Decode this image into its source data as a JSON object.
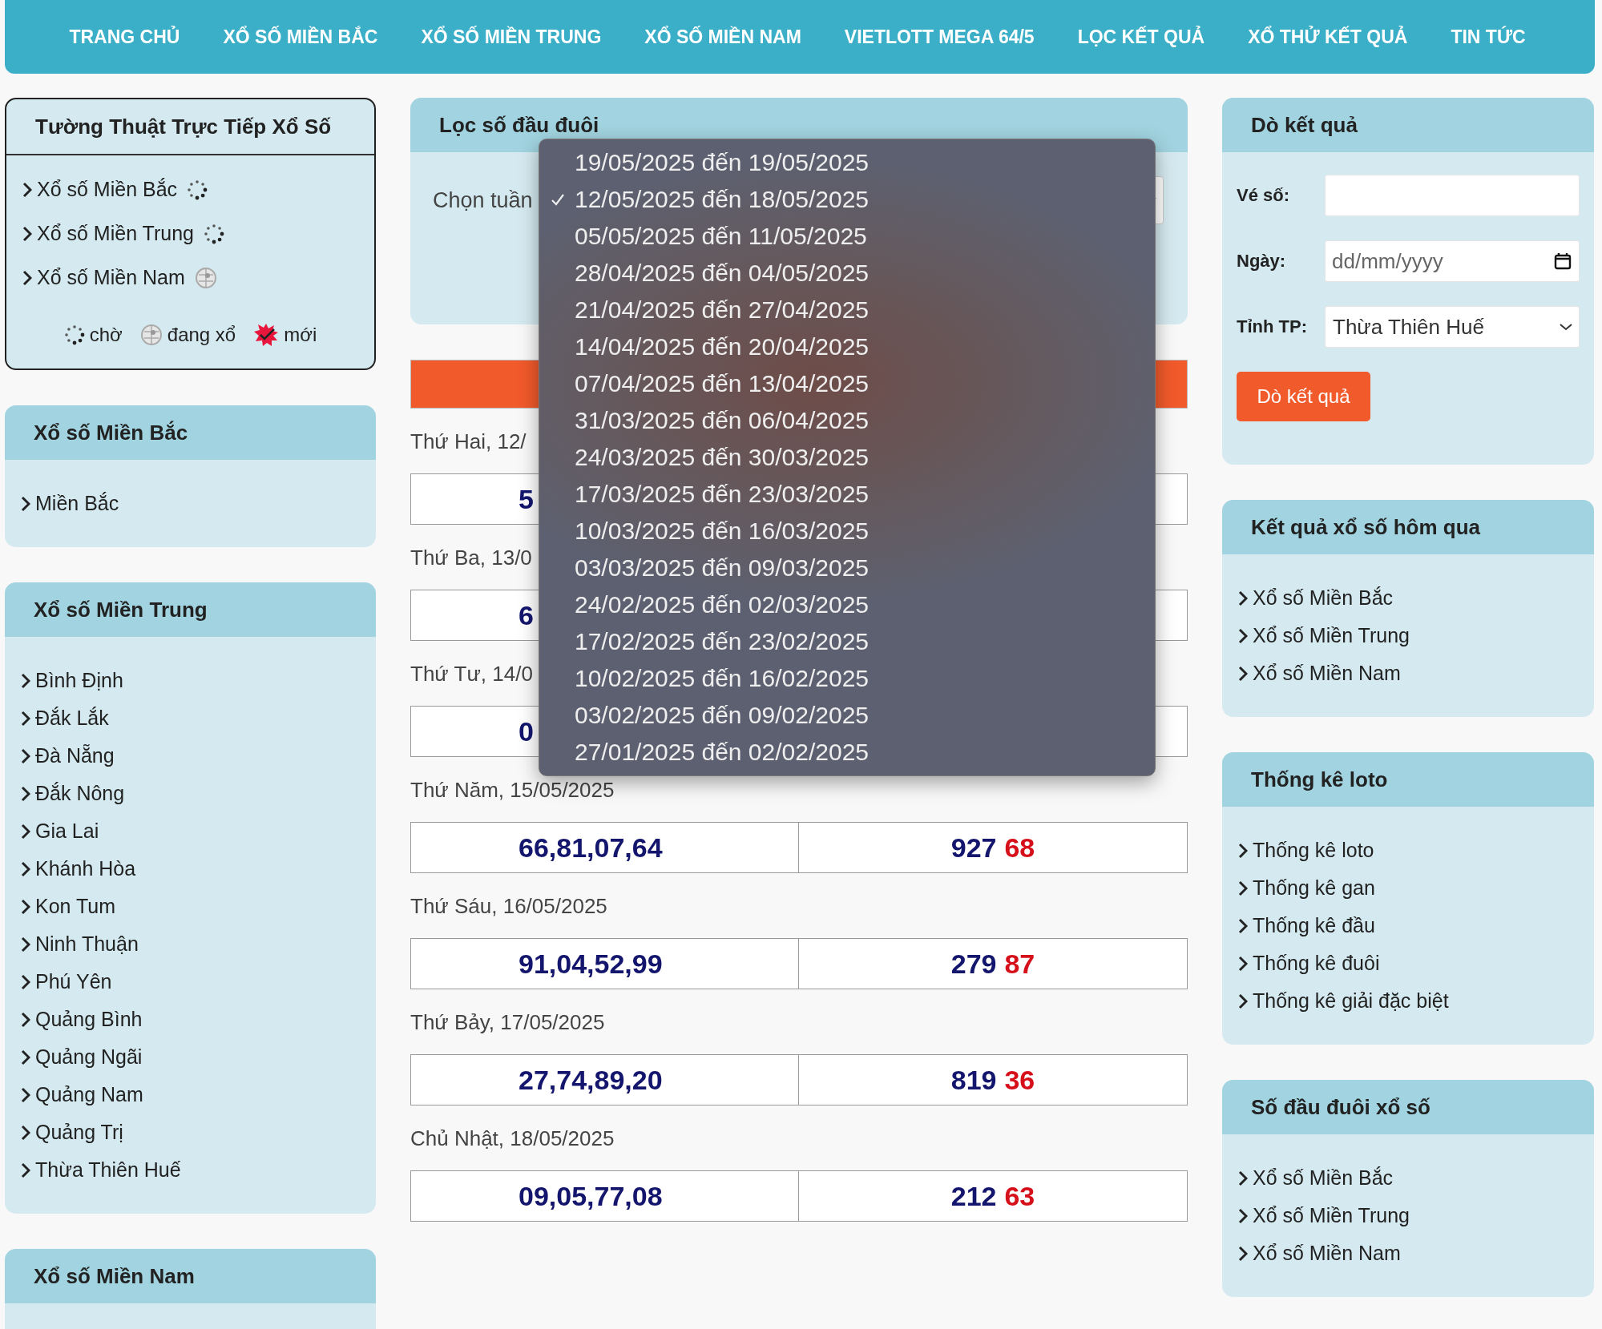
{
  "nav": [
    {
      "label": "TRANG CHỦ"
    },
    {
      "label": "XỔ SỐ MIỀN BẮC"
    },
    {
      "label": "XỔ SỐ MIỀN TRUNG"
    },
    {
      "label": "XỔ SỐ MIỀN NAM"
    },
    {
      "label": "VIETLOTT MEGA 64/5"
    },
    {
      "label": "LỌC KẾT QUẢ"
    },
    {
      "label": "XỔ THỬ KẾT QUẢ"
    },
    {
      "label": "TIN TỨC"
    }
  ],
  "live": {
    "title": "Tường Thuật Trực Tiếp Xổ Số",
    "items": [
      {
        "label": "Xổ số Miền Bắc",
        "kind": "waiting"
      },
      {
        "label": "Xổ số Miền Trung",
        "kind": "waiting"
      },
      {
        "label": "Xổ số Miền Nam",
        "kind": "drawing"
      }
    ],
    "legend": [
      {
        "kind": "waiting",
        "label": "chờ"
      },
      {
        "kind": "drawing",
        "label": "đang xổ"
      },
      {
        "kind": "new",
        "label": "mới"
      }
    ]
  },
  "left_sections": [
    {
      "title": "Xổ số Miền Bắc",
      "items": [
        "Miền Bắc"
      ]
    },
    {
      "title": "Xổ số Miền Trung",
      "items": [
        "Bình Định",
        "Đắk Lắk",
        "Đà Nẵng",
        "Đắk Nông",
        "Gia Lai",
        "Khánh Hòa",
        "Kon Tum",
        "Ninh Thuận",
        "Phú Yên",
        "Quảng Bình",
        "Quảng Ngãi",
        "Quảng Nam",
        "Quảng Trị",
        "Thừa Thiên Huế"
      ]
    },
    {
      "title": "Xổ số Miền Nam"
    }
  ],
  "filter": {
    "title": "Lọc số đầu đuôi",
    "week_label": "Chọn tuần"
  },
  "days": [
    {
      "label": "Thứ Hai, 12/",
      "numbers": "5"
    },
    {
      "label": "Thứ Ba, 13/0",
      "numbers": "6"
    },
    {
      "label": "Thứ Tư, 14/0",
      "numbers": "0"
    },
    {
      "label": "Thứ Năm, 15/05/2025",
      "numbers": "66,81,07,64",
      "special": "927",
      "tail": "68"
    },
    {
      "label": "Thứ Sáu, 16/05/2025",
      "numbers": "91,04,52,99",
      "special": "279",
      "tail": "87"
    },
    {
      "label": "Thứ Bảy, 17/05/2025",
      "numbers": "27,74,89,20",
      "special": "819",
      "tail": "36"
    },
    {
      "label": "Chủ Nhật, 18/05/2025",
      "numbers": "09,05,77,08",
      "special": "212",
      "tail": "63"
    }
  ],
  "week_dropdown": {
    "options": [
      {
        "label": "19/05/2025 đến 19/05/2025",
        "selected": false
      },
      {
        "label": "12/05/2025 đến 18/05/2025",
        "selected": true
      },
      {
        "label": "05/05/2025 đến 11/05/2025",
        "selected": false
      },
      {
        "label": "28/04/2025 đến 04/05/2025",
        "selected": false
      },
      {
        "label": "21/04/2025 đến 27/04/2025",
        "selected": false
      },
      {
        "label": "14/04/2025 đến 20/04/2025",
        "selected": false
      },
      {
        "label": "07/04/2025 đến 13/04/2025",
        "selected": false
      },
      {
        "label": "31/03/2025 đến 06/04/2025",
        "selected": false
      },
      {
        "label": "24/03/2025 đến 30/03/2025",
        "selected": false
      },
      {
        "label": "17/03/2025 đến 23/03/2025",
        "selected": false
      },
      {
        "label": "10/03/2025 đến 16/03/2025",
        "selected": false
      },
      {
        "label": "03/03/2025 đến 09/03/2025",
        "selected": false
      },
      {
        "label": "24/02/2025 đến 02/03/2025",
        "selected": false
      },
      {
        "label": "17/02/2025 đến 23/02/2025",
        "selected": false
      },
      {
        "label": "10/02/2025 đến 16/02/2025",
        "selected": false
      },
      {
        "label": "03/02/2025 đến 09/02/2025",
        "selected": false
      },
      {
        "label": "27/01/2025 đến 02/02/2025",
        "selected": false
      }
    ]
  },
  "lookup": {
    "title": "Dò kết quả",
    "fields": [
      {
        "kind": "text",
        "label": "Vé số:"
      },
      {
        "kind": "date",
        "label": "Ngày:",
        "placeholder": "dd/mm/yyyy"
      },
      {
        "kind": "select",
        "label": "Tỉnh TP:",
        "value": "Thừa Thiên Huế"
      }
    ],
    "button": "Dò kết quả"
  },
  "right_sections": [
    {
      "title": "Kết quả xổ số hôm qua",
      "items": [
        "Xổ số Miền Bắc",
        "Xổ số Miền Trung",
        "Xổ số Miền Nam"
      ]
    },
    {
      "title": "Thống kê loto",
      "items": [
        "Thống kê loto",
        "Thống kê gan",
        "Thống kê đầu",
        "Thống kê đuôi",
        "Thống kê giải đặc biệt"
      ]
    },
    {
      "title": "Số đầu đuôi xổ số",
      "items": [
        "Xổ số Miền Bắc",
        "Xổ số Miền Trung",
        "Xổ số Miền Nam"
      ]
    }
  ]
}
